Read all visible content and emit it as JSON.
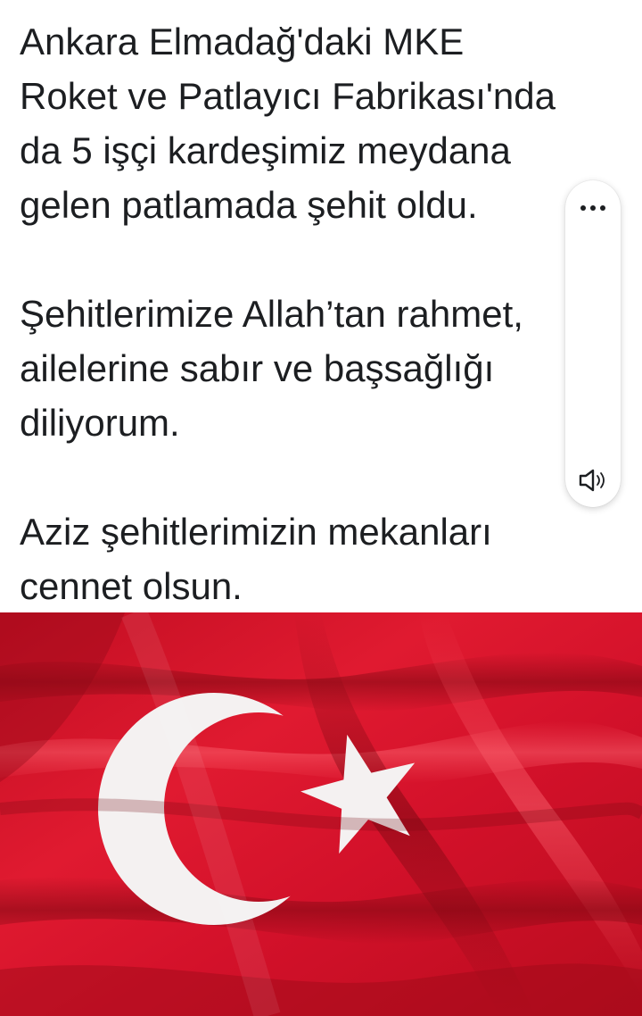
{
  "post": {
    "paragraphs": [
      {
        "lines": [
          "Ankara Elmadağ'daki MKE",
          "Roket ve Patlayıcı Fabrikası'nda",
          "da 5 işçi kardeşimiz meydana",
          "gelen patlamada şehit oldu."
        ]
      },
      {
        "lines": [
          "Şehitlerimize Allah’tan rahmet,",
          "ailelerine sabır ve başsağlığı",
          "diliyorum."
        ]
      },
      {
        "lines": [
          "Aziz şehitlerimizin mekanları",
          "cennet olsun."
        ]
      }
    ]
  },
  "side_panel": {
    "more_icon": "more-horizontal-icon",
    "speaker_icon": "speaker-icon"
  },
  "image": {
    "subject": "turkish-flag",
    "colors": {
      "flag_red": "#d7102a",
      "flag_dark": "#8c0a16",
      "crescent_star": "#f4f1f1"
    }
  }
}
